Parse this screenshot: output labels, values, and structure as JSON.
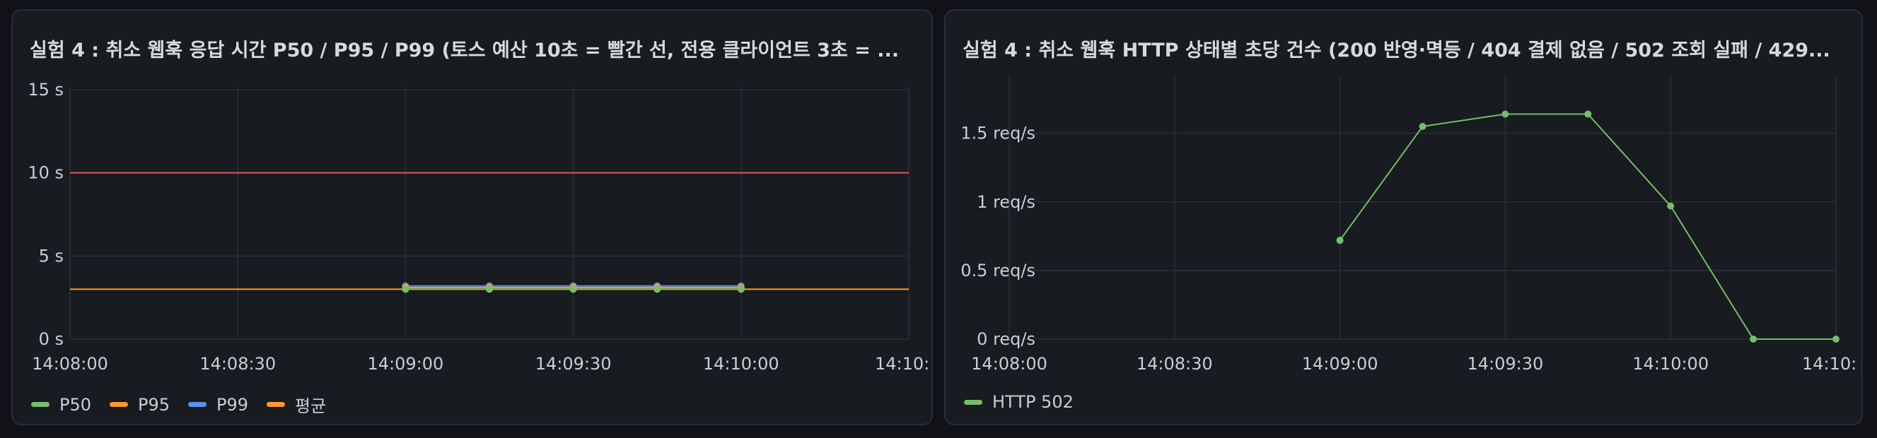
{
  "panels": [
    {
      "title": "실험 4 : 취소 웹훅 응답 시간 P50 / P95 / P99 (토스 예산 10초 = 빨간 선, 전용 클라이언트 3초 = ...",
      "legend": [
        {
          "label": "P50",
          "color": "#73bf69"
        },
        {
          "label": "P95",
          "color": "#ff9830"
        },
        {
          "label": "P99",
          "color": "#5794f2"
        },
        {
          "label": "평균",
          "color": "#ff9830"
        }
      ]
    },
    {
      "title": "실험 4 : 취소 웹훅 HTTP 상태별 초당 건수 (200 반영·멱등 / 404 결제 없음 / 502 조회 실패 / 429...",
      "legend": [
        {
          "label": "HTTP 502",
          "color": "#73bf69"
        }
      ]
    }
  ],
  "chart_data": [
    {
      "type": "line",
      "x_ticks": [
        "14:08:00",
        "14:08:30",
        "14:09:00",
        "14:09:30",
        "14:10:00",
        "14:10:"
      ],
      "y_ticks": [
        "0 s",
        "5 s",
        "10 s",
        "15 s"
      ],
      "ylim": [
        0,
        15
      ],
      "grid": true,
      "legend_position": "bottom-left",
      "x": [
        "14:09:00",
        "14:09:15",
        "14:09:30",
        "14:09:45",
        "14:10:00"
      ],
      "series": [
        {
          "name": "P50",
          "color": "#73bf69",
          "values": [
            3.0,
            3.0,
            3.0,
            3.0,
            3.0
          ]
        },
        {
          "name": "P95",
          "color": "#ff9830",
          "values": [
            3.1,
            3.1,
            3.1,
            3.1,
            3.1
          ]
        },
        {
          "name": "P99",
          "color": "#5794f2",
          "values": [
            3.2,
            3.2,
            3.2,
            3.2,
            3.2
          ]
        },
        {
          "name": "평균",
          "color": "#ff9830",
          "values": [
            3.0,
            3.0,
            3.0,
            3.0,
            3.0
          ]
        }
      ],
      "thresholds": [
        {
          "value": 10,
          "color": "#e0555f"
        },
        {
          "value": 3,
          "color": "#ff9830"
        }
      ]
    },
    {
      "type": "line",
      "x_ticks": [
        "14:08:00",
        "14:08:30",
        "14:09:00",
        "14:09:30",
        "14:10:00",
        "14:10:"
      ],
      "y_ticks": [
        "0 req/s",
        "0.5 req/s",
        "1 req/s",
        "1.5 req/s"
      ],
      "ylim": [
        0,
        1.9
      ],
      "grid": true,
      "legend_position": "bottom-left",
      "x": [
        "14:09:00",
        "14:09:15",
        "14:09:30",
        "14:09:45",
        "14:10:00",
        "14:10:15",
        "14:10:30"
      ],
      "series": [
        {
          "name": "HTTP 502",
          "color": "#73bf69",
          "values": [
            0.72,
            1.55,
            1.64,
            1.64,
            0.97,
            0.0,
            0.0
          ]
        }
      ]
    }
  ]
}
